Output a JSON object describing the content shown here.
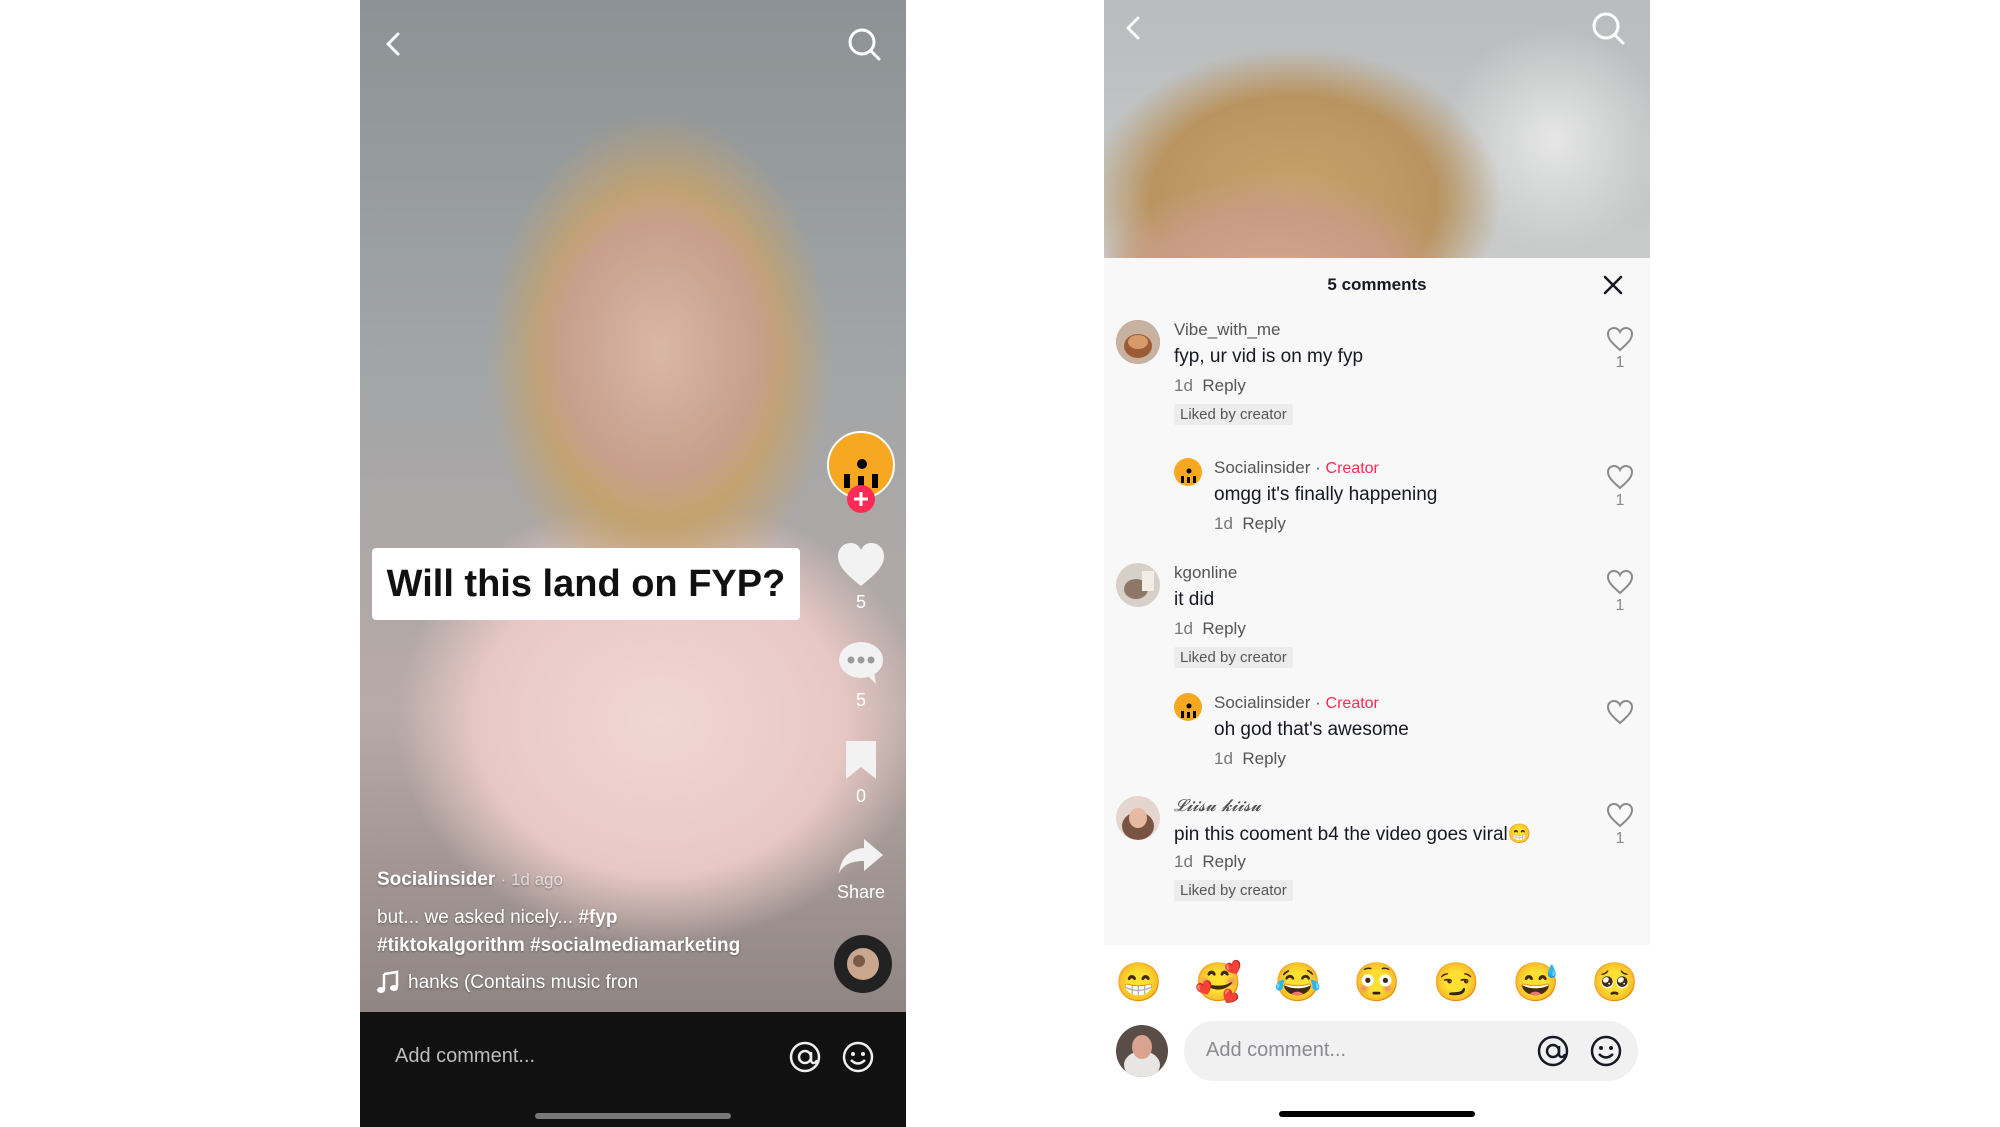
{
  "left": {
    "title_card": "Will this land on FYP?",
    "counts": {
      "likes": "5",
      "comments": "5",
      "saves": "0"
    },
    "share_label": "Share",
    "author": "Socialinsider",
    "time_ago": "· 1d ago",
    "caption_line1": "but... we asked nicely...",
    "caption_tag1": "#fyp",
    "caption_line2": "#tiktokalgorithm #socialmediamarketing",
    "music": "hanks (Contains music fron",
    "comment_placeholder": "Add comment..."
  },
  "right": {
    "sheet_title": "5 comments",
    "comments": [
      {
        "user": "Vibe_with_me",
        "text": "fyp, ur vid is on my fyp",
        "time": "1d",
        "reply": "Reply",
        "badge": "Liked by creator",
        "likes": "1"
      },
      {
        "user": "Socialinsider",
        "creator_sep": "·",
        "creator": "Creator",
        "text": "omgg it's finally happening",
        "time": "1d",
        "reply": "Reply",
        "likes": "1"
      },
      {
        "user": "kgonline",
        "text": "it did",
        "time": "1d",
        "reply": "Reply",
        "badge": "Liked by creator",
        "likes": "1"
      },
      {
        "user": "Socialinsider",
        "creator_sep": "·",
        "creator": "Creator",
        "text": "oh god that's awesome",
        "time": "1d",
        "reply": "Reply"
      },
      {
        "user": "𝓛𝓲𝓲𝓼𝓾 𝓴𝓲𝓲𝓼𝓾",
        "text": "pin this cooment b4 the video goes viral😁",
        "time": "1d",
        "reply": "Reply",
        "badge": "Liked by creator",
        "likes": "1"
      }
    ],
    "emojis": [
      "😁",
      "🥰",
      "😂",
      "😳",
      "😏",
      "😅",
      "🥺"
    ],
    "comment_placeholder": "Add comment..."
  },
  "icons": {
    "back": "chevron-left-icon",
    "search": "search-icon",
    "heart": "heart-icon",
    "comment": "comment-bubble-icon",
    "bookmark": "bookmark-icon",
    "share": "share-arrow-icon",
    "music": "music-note-icon",
    "mention": "at-sign-icon",
    "emoji": "smiley-icon",
    "close": "close-icon"
  },
  "colors": {
    "accent": "#fe2c55",
    "brand_avatar": "#f7a823"
  }
}
